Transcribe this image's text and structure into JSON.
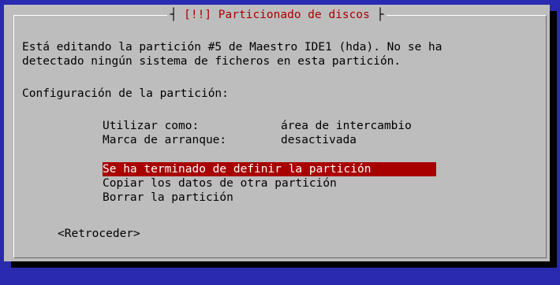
{
  "dialog": {
    "title": "[!!] Particionado de discos",
    "description_line1": "Está editando la partición #5 de Maestro IDE1 (hda). No se ha",
    "description_line2": "detectado ningún sistema de ficheros en esta partición.",
    "config_heading": "Configuración de la partición:",
    "settings": [
      {
        "label": "Utilizar como:",
        "value": "área de intercambio"
      },
      {
        "label": "Marca de arranque:",
        "value": "desactivada"
      }
    ],
    "actions": [
      {
        "label": "Se ha terminado de definir la partición",
        "selected": true
      },
      {
        "label": "Copiar los datos de otra partición",
        "selected": false
      },
      {
        "label": "Borrar la partición",
        "selected": false
      }
    ],
    "back_button": "<Retroceder>"
  },
  "colors": {
    "background": "#2a2ab0",
    "dialog": "#bdbdbd",
    "accent": "#a80000",
    "text": "#000000",
    "highlight_text": "#ffffff"
  }
}
